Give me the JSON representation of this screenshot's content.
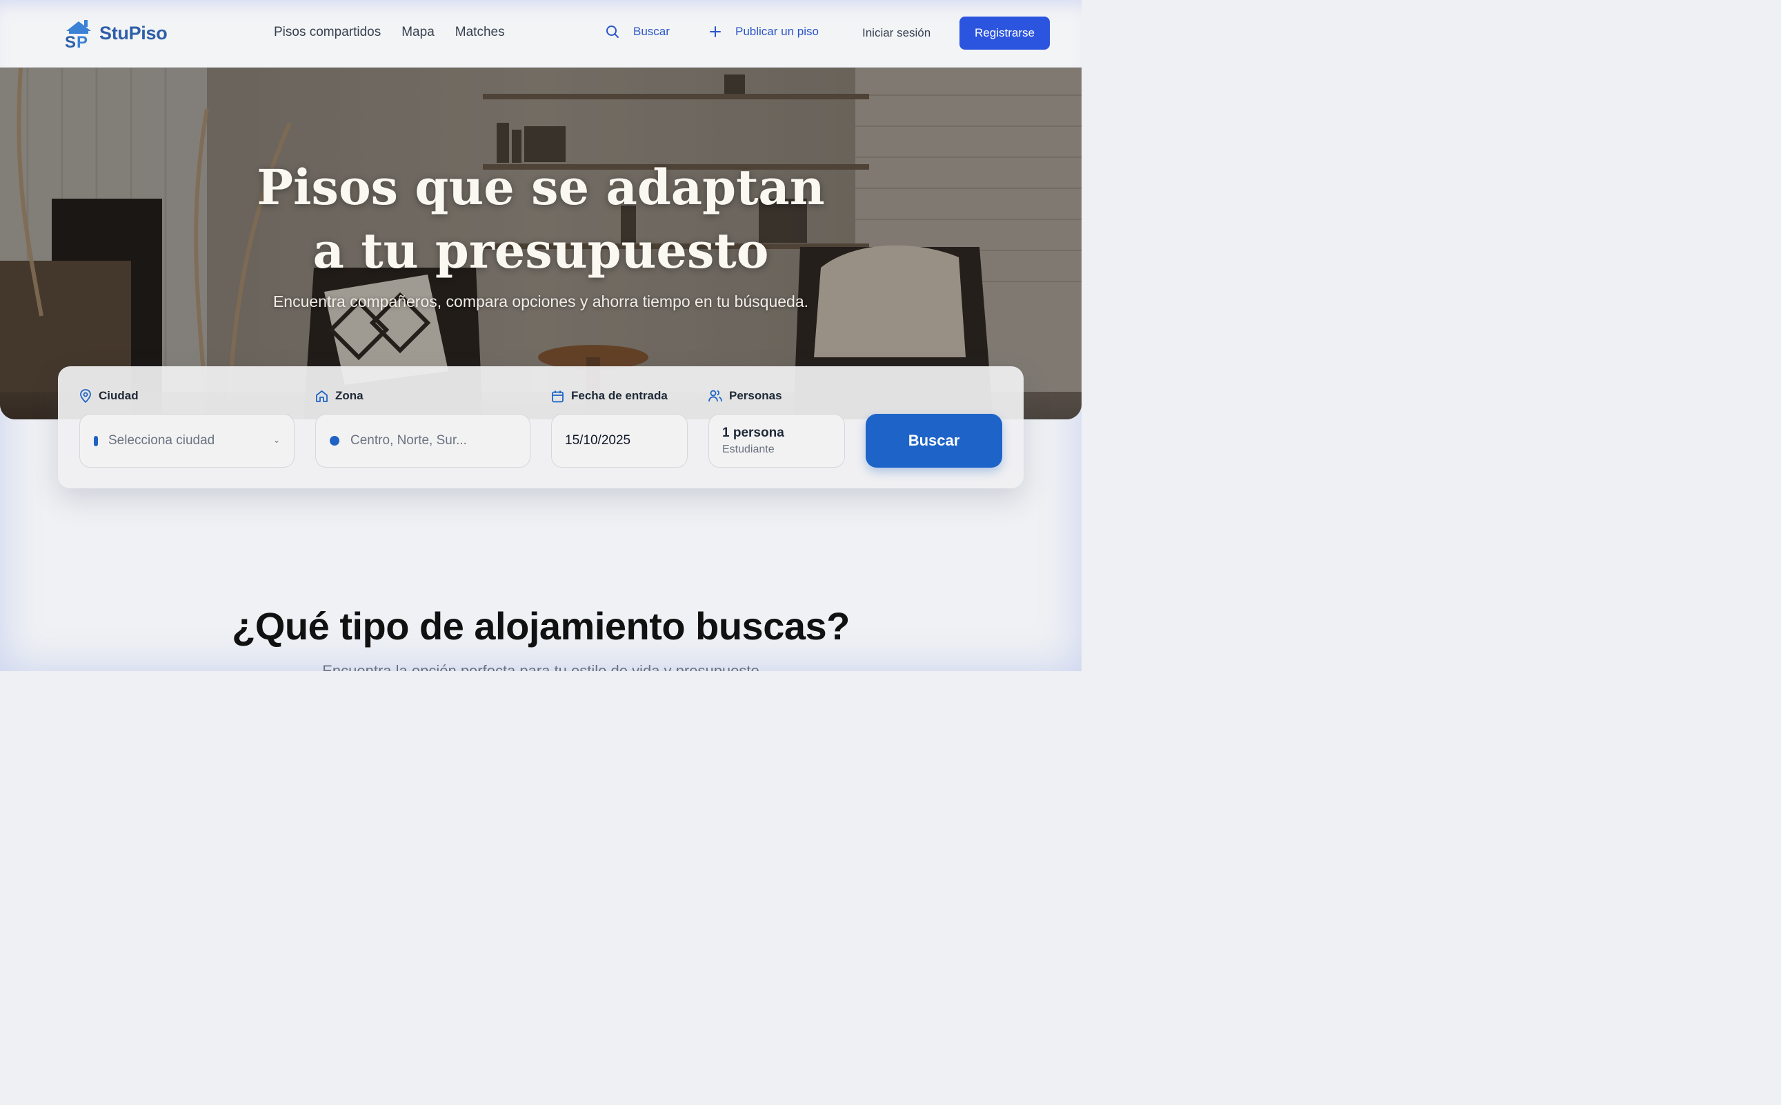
{
  "brand": {
    "name": "StuPiso",
    "primary_color": "#2b55df",
    "accent_color": "#1e64c8"
  },
  "nav": {
    "items": [
      {
        "label": "Pisos compartidos"
      },
      {
        "label": "Mapa"
      },
      {
        "label": "Matches"
      }
    ]
  },
  "header_actions": {
    "search_label": "Buscar",
    "search_icon": "search-icon",
    "publish_label": "Publicar un piso",
    "publish_icon": "plus-icon",
    "login_label": "Iniciar sesión",
    "register_label": "Registrarse"
  },
  "hero": {
    "title_line1": "Pisos que se adaptan",
    "title_line2": "a tu presupuesto",
    "subtitle": "Encuentra compañeros, compara opciones y ahorra tiempo en tu búsqueda."
  },
  "search_form": {
    "city": {
      "label": "Ciudad",
      "icon": "map-pin-icon",
      "placeholder": "Selecciona ciudad"
    },
    "zone": {
      "label": "Zona",
      "icon": "home-icon",
      "placeholder": "Centro, Norte, Sur..."
    },
    "date": {
      "label": "Fecha de entrada",
      "icon": "calendar-icon",
      "value": "15/10/2025"
    },
    "people": {
      "label": "Personas",
      "icon": "users-icon",
      "value": "1 persona",
      "type": "Estudiante"
    },
    "submit_label": "Buscar"
  },
  "section": {
    "title": "¿Qué tipo de alojamiento buscas?",
    "subtitle": "Encuentra la opción perfecta para tu estilo de vida y presupuesto"
  }
}
